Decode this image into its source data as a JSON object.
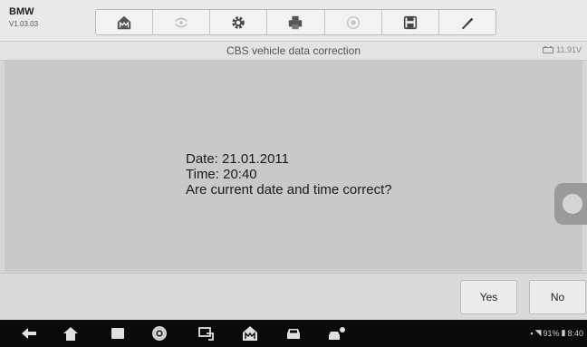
{
  "app": {
    "name": "BMW",
    "version": "V1.03.03"
  },
  "toolbar": {
    "items": [
      {
        "icon": "home-icon",
        "enabled": true
      },
      {
        "icon": "vehicle-swap-icon",
        "enabled": false
      },
      {
        "icon": "settings-gear-icon",
        "enabled": true
      },
      {
        "icon": "printer-icon",
        "enabled": true
      },
      {
        "icon": "help-icon",
        "enabled": false
      },
      {
        "icon": "save-icon",
        "enabled": true
      },
      {
        "icon": "pen-icon",
        "enabled": true
      }
    ]
  },
  "header": {
    "title": "CBS vehicle data correction",
    "voltage": "11.91V"
  },
  "message": {
    "date_line": "Date: 21.01.2011",
    "time_line": "Time: 20:40",
    "question": "Are current date and time correct?"
  },
  "actions": {
    "yes_label": "Yes",
    "no_label": "No"
  },
  "status_bar": {
    "battery": "91%",
    "clock": "8:40"
  },
  "colors": {
    "background": "#c9c9c9",
    "toolbar": "#f2f2f2",
    "navbar": "#0a0a0a"
  }
}
